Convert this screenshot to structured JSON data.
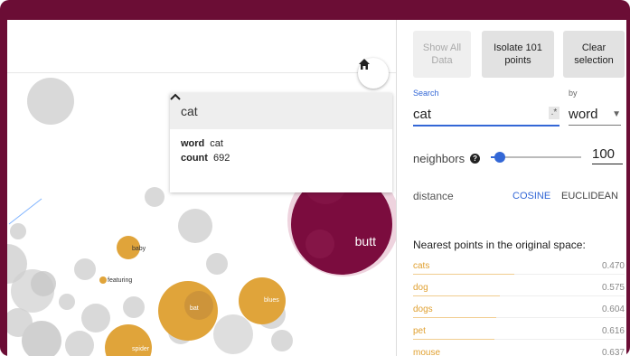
{
  "tooltip": {
    "title": "cat",
    "fields": [
      {
        "key": "word",
        "value": "cat"
      },
      {
        "key": "count",
        "value": "692"
      }
    ]
  },
  "points": {
    "labels": [
      "butt",
      "baby",
      "featuring",
      "bat",
      "blues",
      "spider"
    ]
  },
  "controls": {
    "show_all": "Show All Data",
    "isolate": "Isolate 101 points",
    "clear": "Clear selection"
  },
  "search": {
    "label": "Search",
    "value": "cat",
    "regex": ".*",
    "by_label": "by",
    "by_value": "word"
  },
  "neighbors": {
    "label": "neighbors",
    "value": "100",
    "fraction": 0.1
  },
  "distance": {
    "label": "distance",
    "options": [
      "COSINE",
      "EUCLIDEAN"
    ],
    "selected": "COSINE"
  },
  "nearest": {
    "title": "Nearest points in the original space:",
    "items": [
      {
        "word": "cats",
        "value": "0.470"
      },
      {
        "word": "dog",
        "value": "0.575"
      },
      {
        "word": "dogs",
        "value": "0.604"
      },
      {
        "word": "pet",
        "value": "0.616"
      },
      {
        "word": "mouse",
        "value": "0.637"
      }
    ]
  },
  "colors": {
    "frame": "#6b0d35",
    "selected_point": "#7b0c3e",
    "neighbor_point": "#e0a43a",
    "accent": "#3367d6"
  },
  "icons": [
    "home-icon",
    "chevron-up-icon",
    "help-icon",
    "caret-down-icon"
  ]
}
